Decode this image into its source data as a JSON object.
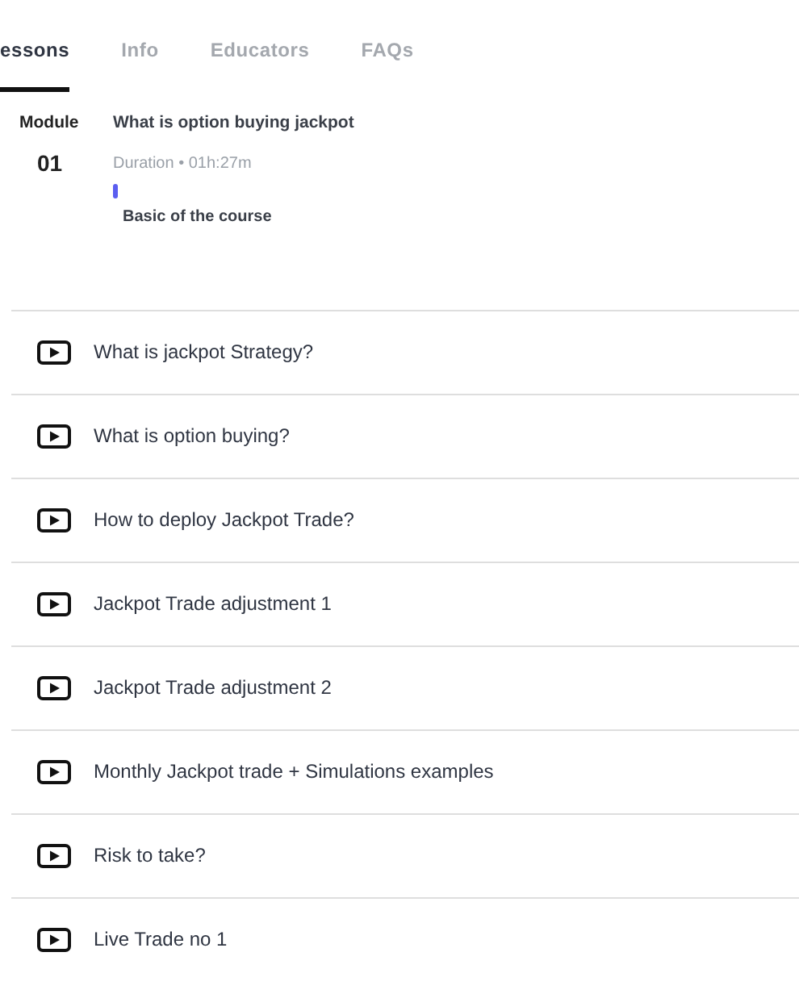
{
  "tabs": [
    {
      "label": "essons",
      "selected": true
    },
    {
      "label": "Info",
      "selected": false
    },
    {
      "label": "Educators",
      "selected": false
    },
    {
      "label": "FAQs",
      "selected": false
    }
  ],
  "module": {
    "label": "Module",
    "number": "01",
    "title": "What is option buying jackpot",
    "duration": "Duration • 01h:27m",
    "subtitle": "Basic of the course"
  },
  "lessons": [
    {
      "title": "What is jackpot Strategy?"
    },
    {
      "title": "What is option buying?"
    },
    {
      "title": "How to deploy Jackpot Trade?"
    },
    {
      "title": "Jackpot Trade adjustment 1"
    },
    {
      "title": "Jackpot Trade adjustment 2"
    },
    {
      "title": "Monthly Jackpot trade + Simulations examples"
    },
    {
      "title": "Risk to take?"
    },
    {
      "title": "Live Trade no 1"
    }
  ]
}
